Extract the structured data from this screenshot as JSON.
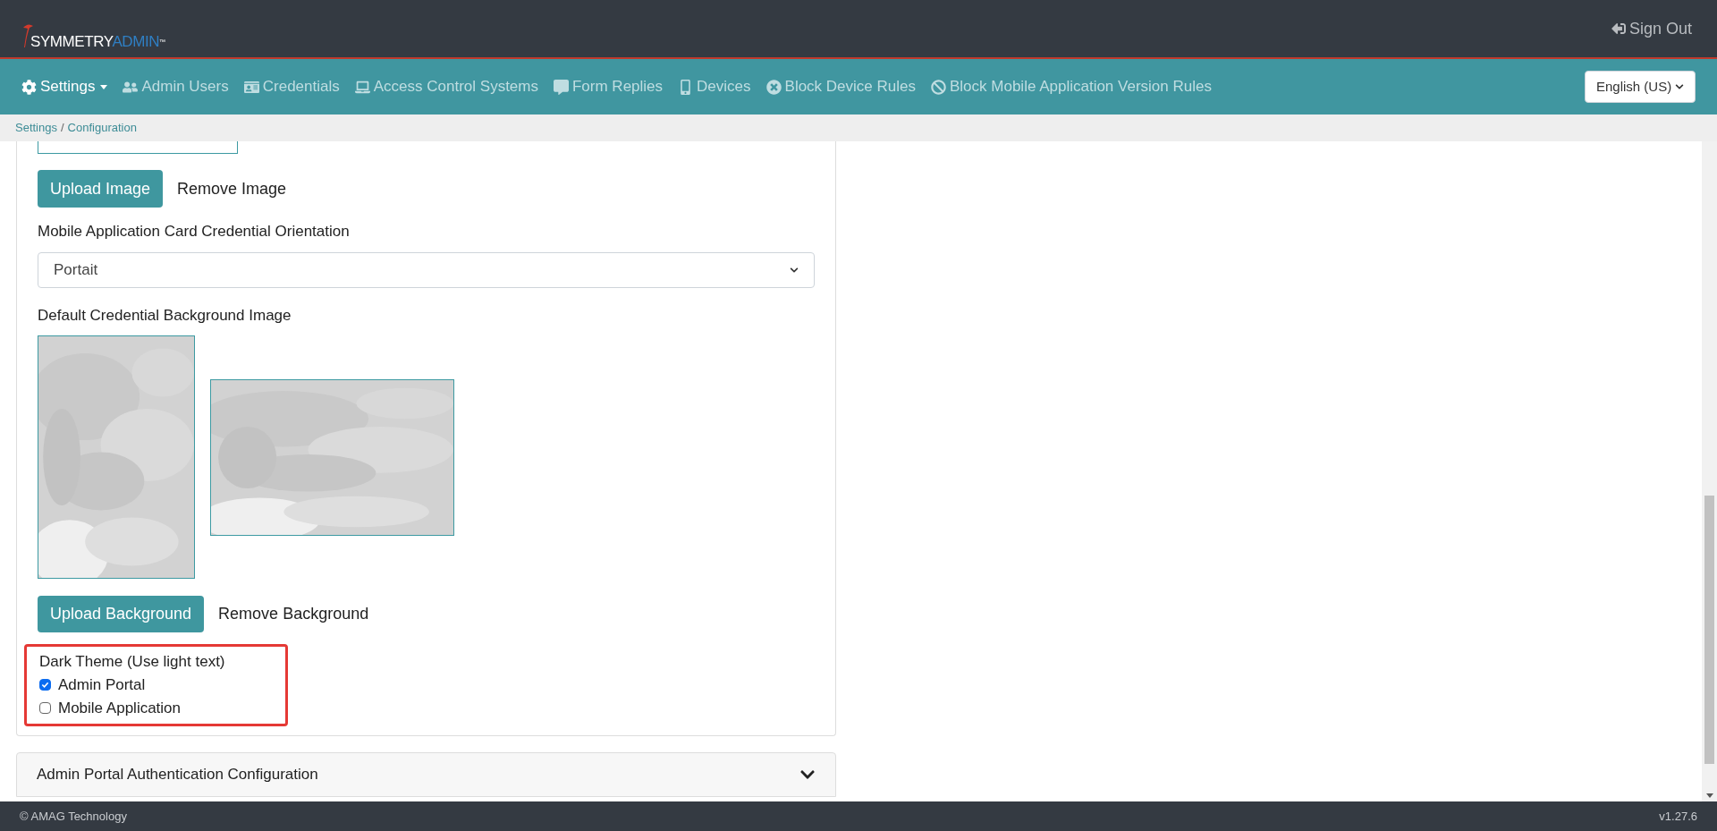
{
  "logo": {
    "primary": "SYMMETRY",
    "accent": "ADMIN",
    "mark": "™"
  },
  "sign_out": "Sign Out",
  "nav": [
    {
      "label": "Settings",
      "selected": true,
      "dropdown": true
    },
    {
      "label": "Admin Users",
      "selected": false
    },
    {
      "label": "Credentials",
      "selected": false
    },
    {
      "label": "Access Control Systems",
      "selected": false
    },
    {
      "label": "Form Replies",
      "selected": false
    },
    {
      "label": "Devices",
      "selected": false
    },
    {
      "label": "Block Device Rules",
      "selected": false
    },
    {
      "label": "Block Mobile Application Version Rules",
      "selected": false
    }
  ],
  "language": {
    "value": "English (US)"
  },
  "breadcrumb": {
    "separator": "/",
    "items": [
      "Settings",
      "Configuration"
    ]
  },
  "form": {
    "image_buttons": {
      "upload": "Upload Image",
      "remove": "Remove Image"
    },
    "orientation": {
      "label": "Mobile Application Card Credential Orientation",
      "value": "Portait"
    },
    "background": {
      "label": "Default Credential Background Image"
    },
    "background_buttons": {
      "upload": "Upload Background",
      "remove": "Remove Background"
    },
    "dark_theme": {
      "label": "Dark Theme (Use light text)",
      "highlighted": true,
      "options": [
        {
          "label": "Admin Portal",
          "checked": true
        },
        {
          "label": "Mobile Application",
          "checked": false
        }
      ]
    }
  },
  "accordion": {
    "title": "Admin Portal Authentication Configuration",
    "expanded": false
  },
  "footer": {
    "copyright": "© AMAG Technology",
    "version": "v1.27.6"
  }
}
